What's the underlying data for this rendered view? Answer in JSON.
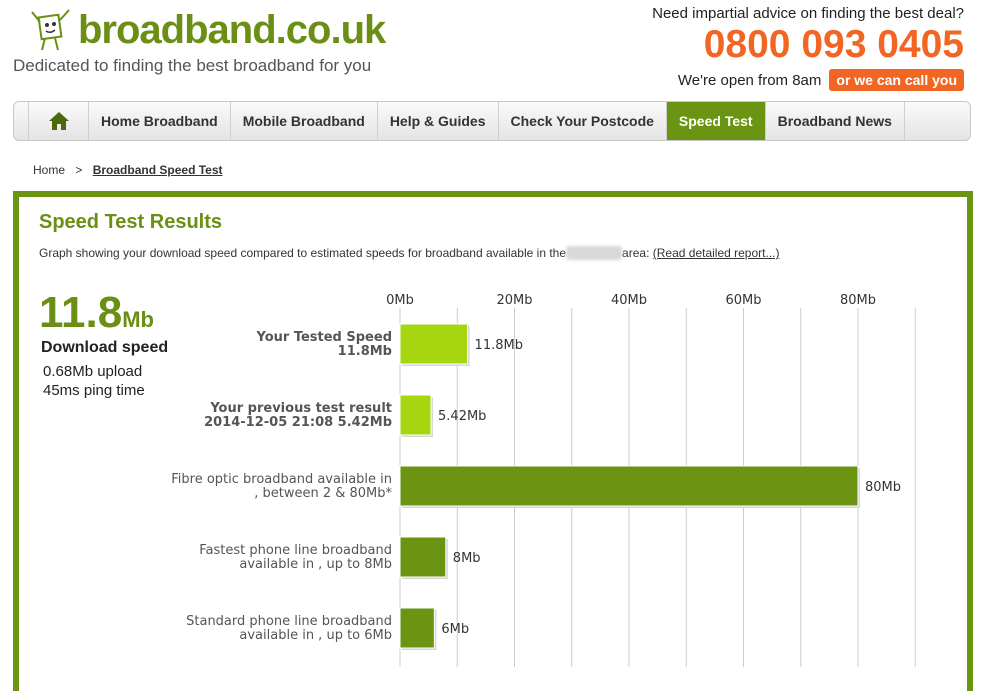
{
  "header": {
    "logo_text": "broadband.co.uk",
    "tagline": "Dedicated to finding the best broadband for you",
    "advice": "Need impartial advice on finding the best deal?",
    "phone": "0800 093 0405",
    "open_hours": "We're open from 8am",
    "callback_label": "or we can call you"
  },
  "nav": {
    "items": [
      {
        "label": "Home Broadband"
      },
      {
        "label": "Mobile Broadband"
      },
      {
        "label": "Help & Guides"
      },
      {
        "label": "Check Your Postcode"
      },
      {
        "label": "Speed Test"
      },
      {
        "label": "Broadband News"
      }
    ],
    "active_index": 4
  },
  "breadcrumb": {
    "home": "Home",
    "separator": ">",
    "current": "Broadband Speed Test"
  },
  "results": {
    "title": "Speed Test Results",
    "description_before": "Graph showing your download speed compared to estimated speeds for broadband available in the",
    "description_after": "area:",
    "report_link": "(Read detailed report...)",
    "speed_value": "11.8",
    "speed_unit": "Mb",
    "download_label": "Download speed",
    "upload": "0.68Mb upload",
    "ping": "45ms ping time"
  },
  "colors": {
    "brand_green": "#6a9412",
    "light_green": "#a6d60f",
    "orange": "#f26522"
  },
  "chart_data": {
    "type": "bar",
    "orientation": "horizontal",
    "xlim": [
      0,
      80
    ],
    "ticks": [
      "0Mb",
      "20Mb",
      "40Mb",
      "60Mb",
      "80Mb"
    ],
    "rows": [
      {
        "label_line1": "Your Tested Speed",
        "label_line2": "11.8Mb",
        "value": 11.8,
        "value_label": "11.8Mb",
        "style": "light",
        "label_bold": true
      },
      {
        "label_line1": "Your previous test result",
        "label_line2": "2014-12-05 21:08  5.42Mb",
        "value": 5.42,
        "value_label": "5.42Mb",
        "style": "light",
        "label_bold": true
      },
      {
        "label_line1": "Fibre optic broadband available in",
        "label_line2": ", between 2 & 80Mb*",
        "value": 80,
        "value_label": "80Mb",
        "style": "dark",
        "label_bold": false
      },
      {
        "label_line1": "Fastest phone line broadband",
        "label_line2": "available in , up to 8Mb",
        "value": 8,
        "value_label": "8Mb",
        "style": "dark",
        "label_bold": false
      },
      {
        "label_line1": "Standard phone line broadband",
        "label_line2": "available in , up to 6Mb",
        "value": 6,
        "value_label": "6Mb",
        "style": "dark",
        "label_bold": false
      }
    ]
  }
}
